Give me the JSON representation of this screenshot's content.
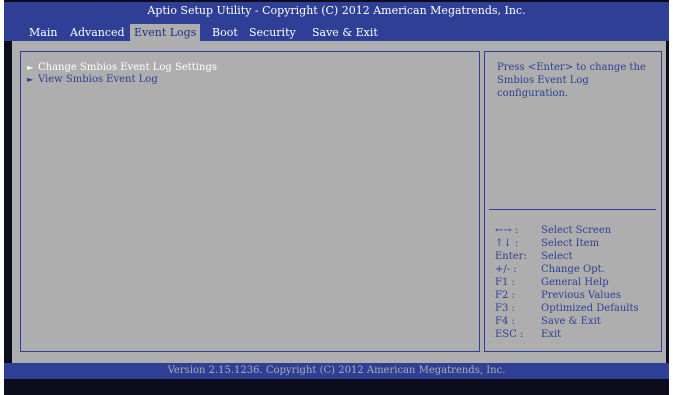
{
  "title": "Aptio Setup Utility - Copyright (C) 2012 American Megatrends, Inc.",
  "menu": [
    "Main",
    "Advanced",
    "Event Logs",
    "Boot",
    "Security",
    "Save & Exit"
  ],
  "active_menu": "Event Logs",
  "entries": [
    {
      "label": "Change Smbios Event Log Settings",
      "arrow": "►",
      "selected": true
    },
    {
      "label": "View Smbios Event Log",
      "arrow": "►",
      "selected": false
    }
  ],
  "help": {
    "text": "Press <Enter> to change the Smbios Event Log configuration.",
    "keys": [
      {
        "key": "←→ :",
        "action": "Select Screen"
      },
      {
        "key": "↑↓ :",
        "action": "Select Item"
      },
      {
        "key": "Enter:",
        "action": "Select"
      },
      {
        "key": "+/- :",
        "action": "Change Opt."
      },
      {
        "key": "F1 :",
        "action": "General Help"
      },
      {
        "key": "F2 :",
        "action": "Previous Values"
      },
      {
        "key": "F3 :",
        "action": "Optimized Defaults"
      },
      {
        "key": "F4 :",
        "action": "Save & Exit"
      },
      {
        "key": "ESC :",
        "action": "Exit"
      }
    ]
  },
  "footer": "Version 2.15.1236. Copyright (C) 2012 American Megatrends, Inc.",
  "colors": {
    "primary_blue": "#2f3f95",
    "panel_gray": "#aeaeae",
    "highlight": "#ffffff"
  }
}
